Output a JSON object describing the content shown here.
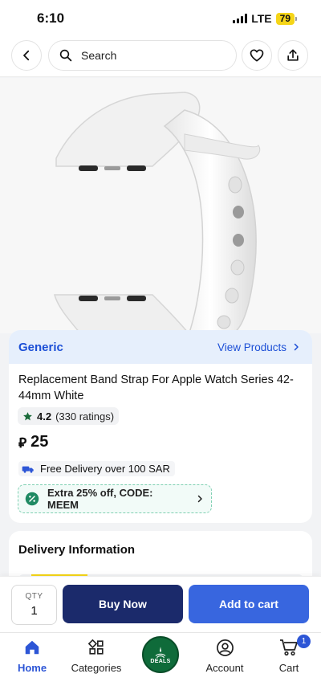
{
  "status_bar": {
    "time": "6:10",
    "network": "LTE",
    "battery": "79"
  },
  "nav": {
    "search_placeholder": "Search"
  },
  "product": {
    "brand": "Generic",
    "view_products_label": "View Products",
    "title": "Replacement Band Strap For Apple Watch Series 42-44mm White",
    "rating": "4.2",
    "ratings_count": "(330 ratings)",
    "currency_symbol": "⃁",
    "price": "25",
    "delivery_note": "Free Delivery over 100 SAR",
    "coupon": "Extra 25% off, CODE: MEEM"
  },
  "delivery_section": {
    "heading": "Delivery Information"
  },
  "actions": {
    "qty_label": "QTY",
    "qty_value": "1",
    "buy_now": "Buy Now",
    "add_to_cart": "Add to cart"
  },
  "tabs": {
    "home": "Home",
    "categories": "Categories",
    "deals": "DEALS",
    "account": "Account",
    "cart": "Cart",
    "cart_badge": "1"
  },
  "colors": {
    "brand_blue": "#1c4fd6",
    "buy_now_bg": "#1b2a6b",
    "add_to_cart_bg": "#3866df",
    "deals_green": "#0f6b3a",
    "coupon_green": "#7fd0b2",
    "rating_star": "#1a6b3a"
  }
}
